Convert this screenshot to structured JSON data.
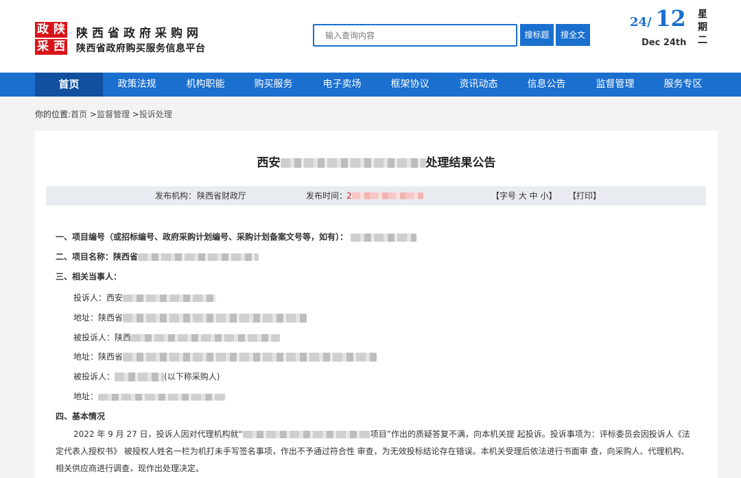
{
  "logo": {
    "glyphs": [
      "政",
      "陕",
      "采",
      "西"
    ]
  },
  "site": {
    "title": "陕西省政府采购网",
    "subtitle": "陕西省政府购买服务信息平台"
  },
  "search": {
    "placeholder": "输入查询内容",
    "btn_title": "搜标题",
    "btn_full": "搜全文"
  },
  "date": {
    "year": "24",
    "slash": "/",
    "month": "12",
    "en": "Dec 24th",
    "weekday": [
      "星",
      "期",
      "二"
    ]
  },
  "nav": {
    "items": [
      "首页",
      "政策法规",
      "机构职能",
      "购买服务",
      "电子卖场",
      "框架协议",
      "资讯动态",
      "信息公告",
      "监督管理",
      "服务专区"
    ]
  },
  "breadcrumb": {
    "prefix": "你的位置:",
    "home": "首页",
    "sep1": " >",
    "level1": "监督管理",
    "sep2": " >",
    "level2": "投诉处理"
  },
  "article": {
    "title_start": "西安",
    "title_end": "处理结果公告",
    "publisher_label": "发布机构：",
    "publisher": "陕西省财政厅",
    "time_label": "发布时间：",
    "time_value": "2",
    "font_size": "【字号 大 中 小】",
    "print": "【打印】",
    "lines": {
      "s1": "一、项目编号（或招标编号、政府采购计划编号、采购计划备案文号等，如有）：",
      "s2": "二、项目名称：陕西省",
      "s3": "三、相关当事人：",
      "complainant": "投诉人：西安",
      "addr1": "地址：陕西省",
      "respondent1": "被投诉人：陕西",
      "addr2": "地址：陕西省",
      "respondent2": "被投诉人：",
      "respondent2_note": "(以下称采购人)",
      "addr3": "地址：",
      "s4": "四、基本情况"
    },
    "para_start": "2022 年 9 月 27 日，投诉人因对代理机构就“",
    "para_middle": "项目”作出的质疑答复不满，向本机关提 起投诉。投诉事项为：评标委员会因投诉人《法定代表人授权书》 被授权人姓名一栏为机打未手写签名事项，作出不予通过符合性 审查，为无效投标结论存在错误。本机关受理后依法进行书面审 查，向采购人、代理机构、相关供应商进行调查，现作出处理决定。"
  },
  "colors": {
    "primary": "#1a6fcf",
    "nav_active": "#10509f",
    "logo_red": "#d8141b"
  }
}
